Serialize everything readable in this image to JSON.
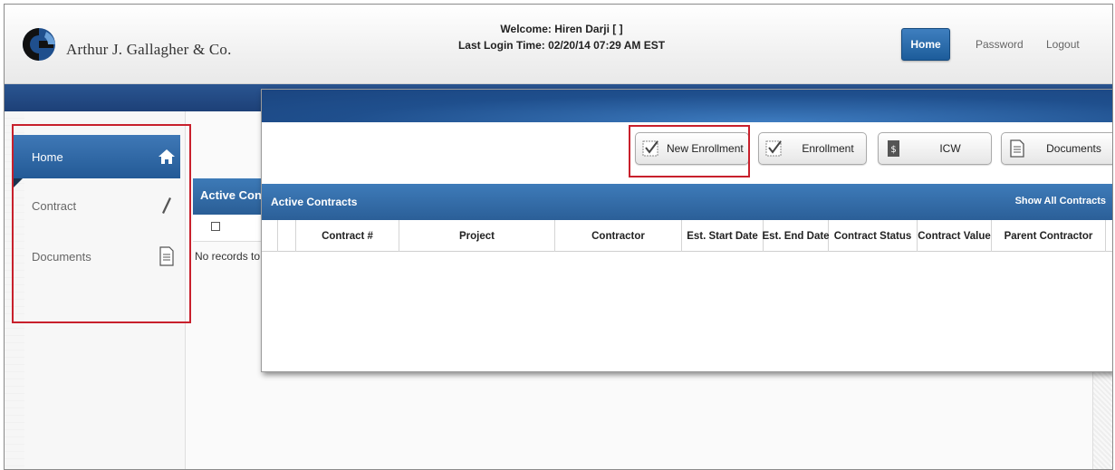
{
  "header": {
    "brand": "Arthur J. Gallagher & Co.",
    "welcome": "Welcome: Hiren Darji [ ]",
    "last_login": "Last Login Time: 02/20/14 07:29 AM EST",
    "nav": {
      "home": "Home",
      "password": "Password",
      "logout": "Logout"
    }
  },
  "sidebar": {
    "items": [
      {
        "label": "Home",
        "icon": "home-icon"
      },
      {
        "label": "Contract",
        "icon": "pencil-icon"
      },
      {
        "label": "Documents",
        "icon": "document-icon"
      }
    ]
  },
  "background_page": {
    "table_title": "Active Cont",
    "no_records": "No records to"
  },
  "overlay": {
    "buttons": [
      {
        "label": "New Enrollment",
        "icon": "checklist-icon"
      },
      {
        "label": "Enrollment",
        "icon": "checklist-icon"
      },
      {
        "label": "ICW",
        "icon": "dollar-document-icon"
      },
      {
        "label": "Documents",
        "icon": "document-icon"
      }
    ],
    "table_title": "Active Contracts",
    "show_all": "Show All Contracts",
    "columns": [
      "",
      "",
      "Contract #",
      "Project",
      "Contractor",
      "Est. Start Date",
      "Est. End Date",
      "Contract Status",
      "Contract Value",
      "Parent Contractor"
    ]
  },
  "colors": {
    "primary_blue": "#2b5f98",
    "highlight_red": "#c8202c"
  }
}
